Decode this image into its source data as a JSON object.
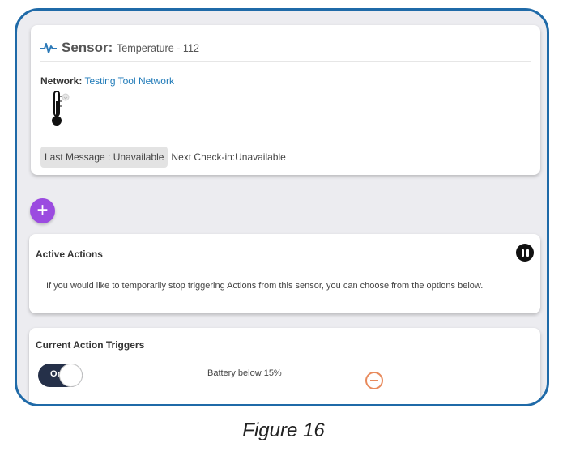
{
  "sensor": {
    "title": "Sensor:",
    "name": "Temperature - 112",
    "network_label": "Network:",
    "network_value": "Testing Tool Network",
    "last_message": "Last Message : Unavailable",
    "next_checkin": "Next Check-in:Unavailable",
    "icon": "thermometer-icon"
  },
  "add_button": {
    "label": "+"
  },
  "active_actions": {
    "title": "Active Actions",
    "description": "If you would like to temporarily stop triggering Actions from this sensor, you can choose from the options below."
  },
  "triggers": {
    "title": "Current Action Triggers",
    "toggle_label": "On",
    "items": [
      {
        "text": "Battery below 15%"
      }
    ]
  },
  "caption": "Figure 16",
  "colors": {
    "frame": "#1f6aa8",
    "accent_purple": "#9b4be0",
    "link_blue": "#1f7ab8",
    "toggle_bg": "#253049",
    "remove_orange": "#e88a5c"
  }
}
